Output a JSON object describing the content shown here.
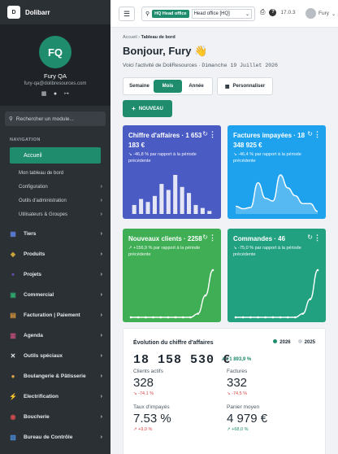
{
  "app": {
    "brand": "Dolibarr",
    "brand_logo": "D",
    "version": "17.0.3"
  },
  "profile": {
    "initials": "FQ",
    "name": "Fury QA",
    "email": "fury-qa@dolibresources.com"
  },
  "sidebar": {
    "search_placeholder": "Rechercher un module...",
    "nav_label": "NAVIGATION",
    "active": "Accueil",
    "sub": [
      {
        "label": "Mon tableau de bord",
        "chevron": ""
      },
      {
        "label": "Configuration",
        "chevron": "›"
      },
      {
        "label": "Outils d'administration",
        "chevron": "›"
      },
      {
        "label": "Utilisateurs & Groupes",
        "chevron": "›"
      }
    ],
    "modules": [
      {
        "label": "Tiers",
        "icon": "building-icon",
        "glyph": "▦",
        "color": "#5b7bd5"
      },
      {
        "label": "Produits",
        "icon": "box-icon",
        "glyph": "◆",
        "color": "#c8a23a"
      },
      {
        "label": "Projets",
        "icon": "sitemap-icon",
        "glyph": "⚬",
        "color": "#7b5bd5"
      },
      {
        "label": "Commercial",
        "icon": "briefcase-icon",
        "glyph": "▣",
        "color": "#2fa36b"
      },
      {
        "label": "Facturation | Paiement",
        "icon": "invoice-icon",
        "glyph": "▤",
        "color": "#d5913b"
      },
      {
        "label": "Agenda",
        "icon": "calendar-icon",
        "glyph": "▥",
        "color": "#c8507b"
      },
      {
        "label": "Outils spéciaux",
        "icon": "tools-icon",
        "glyph": "✕",
        "color": "#e6e9ec"
      },
      {
        "label": "Boulangerie & Pâtisserie",
        "icon": "bread-icon",
        "glyph": "●",
        "color": "#e0a44a"
      },
      {
        "label": "Electrification",
        "icon": "bolt-icon",
        "glyph": "⚡",
        "color": "#f2c230"
      },
      {
        "label": "Boucherie",
        "icon": "meat-icon",
        "glyph": "◉",
        "color": "#c84a4a"
      },
      {
        "label": "Bureau de Contrôle",
        "icon": "clipboard-icon",
        "glyph": "▧",
        "color": "#4a8bd5"
      }
    ]
  },
  "topbar": {
    "entity_badge": "HQ Head office",
    "entity_select": "Head office [HQ]",
    "user": "Fury"
  },
  "breadcrumb": {
    "home": "Accueil",
    "current": "Tableau de bord"
  },
  "header": {
    "greeting": "Bonjour, Fury 👋",
    "subtitle_prefix": "Voici l'activité de DoliResources · ",
    "date": "Dimanche 19 Juillet 2026"
  },
  "period": {
    "week": "Semaine",
    "month": "Mois",
    "year": "Année",
    "selected": "Mois"
  },
  "buttons": {
    "customize": "Personnaliser",
    "new": "NOUVEAU"
  },
  "cards": [
    {
      "title": "Chiffre d'affaires · 1 653 183 €",
      "change": "↘ -46,8 % par rapport à la période précédente",
      "color": "#4a5bc4",
      "kind": "bar",
      "values": [
        3,
        5,
        4,
        6,
        10,
        8,
        13,
        9,
        7,
        3,
        2,
        1
      ]
    },
    {
      "title": "Factures impayées · 18 348 925 €",
      "change": "↘ -46,4 % par rapport à la période précédente",
      "color": "#1ea2ee",
      "kind": "area",
      "values": [
        3,
        2,
        2.5,
        12,
        6,
        5,
        15,
        10,
        7,
        4,
        4,
        1
      ]
    },
    {
      "title": "Nouveaux clients · 2258",
      "change": "↗ +156,9 % par rapport à la période précédente",
      "color": "#3fae54",
      "kind": "line",
      "values": [
        0,
        0,
        0,
        0,
        0,
        0,
        0,
        0,
        0,
        1,
        6,
        13
      ]
    },
    {
      "title": "Commandes · 46",
      "change": "↘ -75,0 % par rapport à la période précédente",
      "color": "#22a181",
      "kind": "line",
      "values": [
        0,
        0,
        0,
        0,
        0,
        0,
        0,
        0,
        0,
        1,
        5,
        13
      ]
    }
  ],
  "evolution": {
    "title": "Évolution du chiffre d'affaires",
    "legend_current": "2026",
    "legend_prev": "2025",
    "amount": "18 158 530 €",
    "amount_change": "↗ +1 893,9 %",
    "stats": [
      {
        "label": "Clients actifs",
        "value": "328",
        "change": "↘ -74,1 %",
        "up": false
      },
      {
        "label": "Factures",
        "value": "332",
        "change": "↘ -74,5 %",
        "up": false
      },
      {
        "label": "Taux d'impayés",
        "value": "7.53 %",
        "change": "↗ +9,0 %",
        "up": false
      },
      {
        "label": "Panier moyen",
        "value": "4 979 €",
        "change": "↗ +68,0 %",
        "up": true
      }
    ]
  }
}
